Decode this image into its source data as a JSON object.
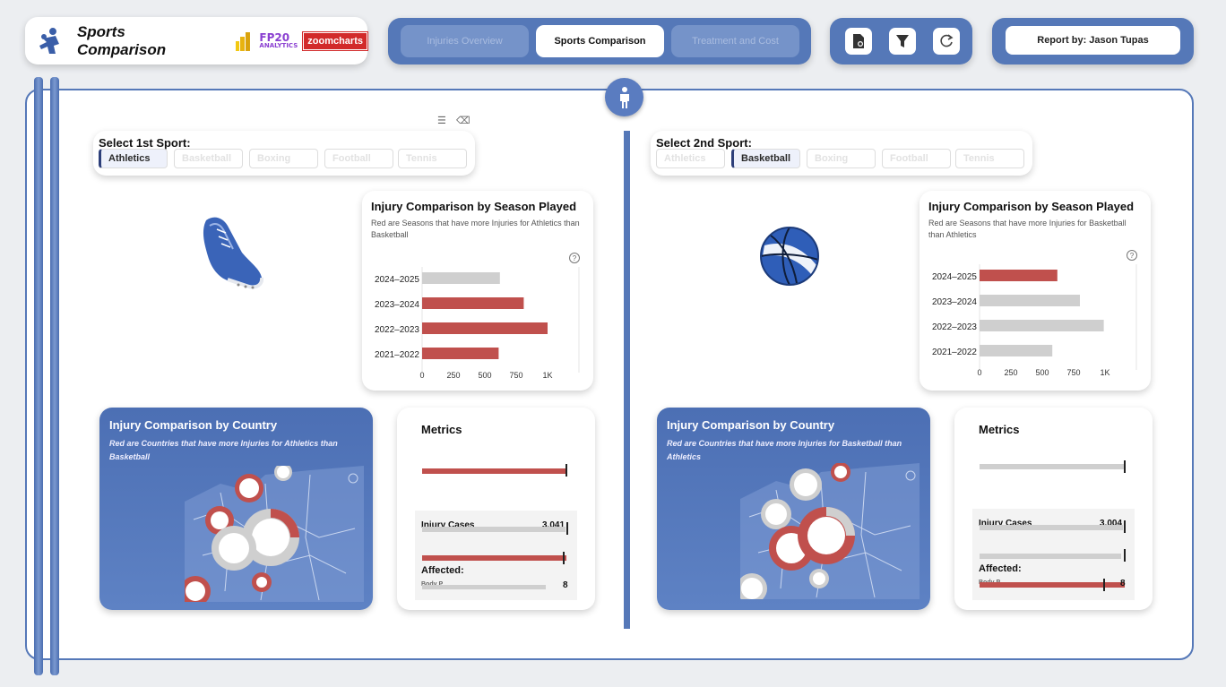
{
  "header": {
    "title": "Sports Comparison",
    "logos": {
      "fp20_top": "FP20",
      "fp20_bottom": "ANALYTICS",
      "zoomcharts": "zoomcharts"
    }
  },
  "nav": {
    "tabs": [
      {
        "label": "Injuries Overview",
        "active": false
      },
      {
        "label": "Sports Comparison",
        "active": true
      },
      {
        "label": "Treatment and Cost",
        "active": false
      }
    ]
  },
  "toolbar": {
    "icons": [
      "report-icon",
      "filter-icon",
      "reset-icon"
    ]
  },
  "author": {
    "label": "Report by: Jason Tupas"
  },
  "sports": [
    "Athletics",
    "Basketball",
    "Boxing",
    "Football",
    "Tennis"
  ],
  "left": {
    "select_label": "Select 1st Sport:",
    "selected": "Athletics",
    "season_chart": {
      "title": "Injury Comparison by Season Played",
      "subtitle": "Red are Seasons that have more Injuries for Athletics than Basketball"
    },
    "map": {
      "title": "Injury Comparison by Country",
      "subtitle": "Red are Countries that have more Injuries for Athletics than Basketball"
    },
    "metrics": {
      "title": "Metrics",
      "injury_cases_label": "Injury Cases",
      "injury_cases_value": "3,041",
      "affected_label": "Affected:",
      "body_part_label": "Body P",
      "body_part_value": "8"
    }
  },
  "right": {
    "select_label": "Select 2nd Sport:",
    "selected": "Basketball",
    "season_chart": {
      "title": "Injury Comparison by Season Played",
      "subtitle": "Red are Seasons that have more Injuries for Basketball than Athletics"
    },
    "map": {
      "title": "Injury Comparison by Country",
      "subtitle": "Red are Countries that have more Injuries for Basketball than Athletics"
    },
    "metrics": {
      "title": "Metrics",
      "injury_cases_label": "Injury Cases",
      "injury_cases_value": "3,004",
      "affected_label": "Affected:",
      "body_part_label": "Body P",
      "body_part_value": "8"
    }
  },
  "colors": {
    "accent": "#5578b8",
    "highlight": "#c0504d",
    "neutral": "#cfcfcf"
  },
  "chart_data": [
    {
      "type": "bar",
      "orientation": "horizontal",
      "categories": [
        "2024–2025",
        "2023–2024",
        "2022–2023",
        "2021–2022"
      ],
      "values": [
        620,
        810,
        1000,
        610
      ],
      "highlight": [
        false,
        true,
        true,
        true
      ],
      "xticks": [
        "0",
        "250",
        "500",
        "750",
        "1K"
      ],
      "xlim": [
        0,
        1250
      ]
    },
    {
      "type": "bar",
      "orientation": "horizontal",
      "categories": [
        "2024–2025",
        "2023–2024",
        "2022–2023",
        "2021–2022"
      ],
      "values": [
        620,
        800,
        990,
        580
      ],
      "highlight": [
        true,
        false,
        false,
        false
      ],
      "xticks": [
        "0",
        "250",
        "500",
        "750",
        "1K"
      ],
      "xlim": [
        0,
        1250
      ]
    }
  ]
}
